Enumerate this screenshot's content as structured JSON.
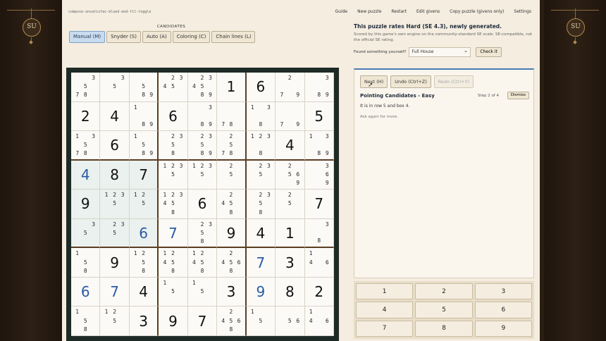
{
  "side_badge": "SU",
  "filename": "compose-unsatisfac-blued-and-fil-toggle",
  "nav": [
    "Guide",
    "New puzzle",
    "Restart",
    "Edit givens",
    "Copy puzzle (givens only)",
    "Settings"
  ],
  "candidates_label": "CANDIDATES",
  "modes": [
    "Manual (M)",
    "Snyder (S)",
    "Auto (A)",
    "Coloring (C)",
    "Chain lines (L)"
  ],
  "rating": {
    "title": "This puzzle rates Hard (SE 4.3), newly generated.",
    "sub": "Scored by this game's own engine on the community-standard SE scale. SE-compatible, not the official SE rating."
  },
  "found": {
    "label": "Found something yourself?",
    "selected": "Full House",
    "check": "Check it"
  },
  "hint": {
    "next": "Next (H)",
    "undo": "Undo (Ctrl+Z)",
    "redo": "Redo (Ctrl+Y)",
    "title": "Pointing Candidates - Easy",
    "step": "Step 2 of 4",
    "dismiss": "Dismiss",
    "text": "It is in row 5 and box 4.",
    "more": "Ask again for more."
  },
  "keypad": [
    "1",
    "2",
    "3",
    "4",
    "5",
    "6",
    "7",
    "8",
    "9"
  ],
  "board": [
    [
      {
        "c": [
          3,
          5,
          7,
          8
        ]
      },
      {
        "c": [
          3,
          5
        ]
      },
      {
        "c": [
          5,
          8,
          9
        ]
      },
      {
        "c": [
          2,
          3,
          4,
          5
        ]
      },
      {
        "c": [
          2,
          3,
          4,
          5,
          8,
          9
        ]
      },
      {
        "v": "1"
      },
      {
        "v": "6"
      },
      {
        "c": [
          2,
          7,
          9
        ]
      },
      {
        "c": [
          3,
          8,
          9
        ]
      }
    ],
    [
      {
        "v": "2"
      },
      {
        "v": "4"
      },
      {
        "c": [
          1,
          8,
          9
        ]
      },
      {
        "v": "6"
      },
      {
        "c": [
          3,
          8,
          9
        ]
      },
      {
        "c": [
          7,
          8
        ]
      },
      {
        "c": [
          1,
          3,
          8
        ]
      },
      {
        "c": [
          7,
          9
        ]
      },
      {
        "v": "5"
      }
    ],
    [
      {
        "c": [
          1,
          3,
          5,
          7,
          8
        ]
      },
      {
        "v": "6"
      },
      {
        "c": [
          1,
          5,
          8,
          9
        ]
      },
      {
        "c": [
          2,
          3,
          5,
          8
        ]
      },
      {
        "c": [
          2,
          3,
          5,
          8,
          9
        ]
      },
      {
        "c": [
          2,
          5,
          7,
          8
        ]
      },
      {
        "c": [
          1,
          2,
          3,
          8
        ]
      },
      {
        "v": "4"
      },
      {
        "c": [
          1,
          3,
          8,
          9
        ]
      }
    ],
    [
      {
        "v": "4",
        "u": true,
        "h": true
      },
      {
        "v": "8",
        "h": true
      },
      {
        "v": "7",
        "h": true
      },
      {
        "c": [
          1,
          2,
          3,
          5
        ]
      },
      {
        "c": [
          1,
          2,
          3,
          5
        ]
      },
      {
        "c": [
          2,
          5
        ]
      },
      {
        "c": [
          2,
          3,
          5
        ]
      },
      {
        "c": [
          2,
          5,
          6,
          9
        ]
      },
      {
        "c": [
          3,
          6,
          9
        ]
      }
    ],
    [
      {
        "v": "9",
        "h": true
      },
      {
        "c": [
          1,
          2,
          3,
          5
        ],
        "h": true
      },
      {
        "c": [
          1,
          2,
          5
        ],
        "h": true
      },
      {
        "c": [
          1,
          2,
          3,
          4,
          5,
          8
        ]
      },
      {
        "v": "6"
      },
      {
        "c": [
          2,
          4,
          5,
          8
        ]
      },
      {
        "c": [
          2,
          3,
          5,
          8
        ]
      },
      {
        "c": [
          2,
          5
        ]
      },
      {
        "v": "7"
      }
    ],
    [
      {
        "c": [
          3,
          5
        ],
        "h": true
      },
      {
        "c": [
          2,
          3,
          5
        ],
        "h": true
      },
      {
        "v": "6",
        "u": true,
        "h": true
      },
      {
        "v": "7",
        "u": true
      },
      {
        "c": [
          2,
          3,
          5,
          8
        ]
      },
      {
        "v": "9"
      },
      {
        "v": "4"
      },
      {
        "v": "1"
      },
      {
        "c": [
          3,
          8
        ]
      }
    ],
    [
      {
        "c": [
          1,
          5,
          8
        ]
      },
      {
        "v": "9"
      },
      {
        "c": [
          1,
          2,
          5,
          8
        ]
      },
      {
        "c": [
          1,
          2,
          4,
          5,
          8
        ]
      },
      {
        "c": [
          1,
          2,
          4,
          5,
          8
        ]
      },
      {
        "c": [
          2,
          4,
          5,
          6,
          8
        ]
      },
      {
        "v": "7",
        "u": true
      },
      {
        "v": "3"
      },
      {
        "c": [
          1,
          4,
          6
        ]
      }
    ],
    [
      {
        "v": "6",
        "u": true
      },
      {
        "v": "7",
        "u": true
      },
      {
        "v": "4"
      },
      {
        "c": [
          1,
          5
        ]
      },
      {
        "c": [
          1,
          5
        ]
      },
      {
        "v": "3"
      },
      {
        "v": "9",
        "u": true
      },
      {
        "v": "8"
      },
      {
        "v": "2"
      }
    ],
    [
      {
        "c": [
          1,
          5,
          8
        ]
      },
      {
        "c": [
          1,
          2,
          5
        ]
      },
      {
        "v": "3"
      },
      {
        "v": "9"
      },
      {
        "v": "7"
      },
      {
        "c": [
          2,
          4,
          5,
          6,
          8
        ]
      },
      {
        "c": [
          1,
          5
        ]
      },
      {
        "c": [
          5,
          6
        ]
      },
      {
        "c": [
          1,
          4,
          6
        ]
      }
    ]
  ]
}
